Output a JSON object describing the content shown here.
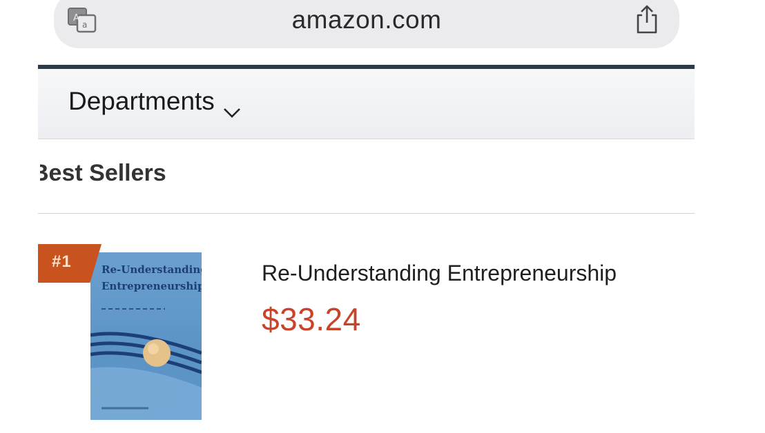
{
  "browser": {
    "domain": "amazon.com"
  },
  "departments": {
    "label": "Departments"
  },
  "section": {
    "title": "Best Sellers"
  },
  "product": {
    "rank": "#1",
    "title": "Re-Understanding Entrepreneurship",
    "price": "$33.24",
    "cover_title_line1": "Re-Understanding",
    "cover_title_line2": "Entrepreneurship"
  },
  "colors": {
    "nav_accent": "#2c3a4a",
    "price": "#c8432a",
    "rank_badge": "#c8531e",
    "book_cover": "#5d94c8"
  }
}
